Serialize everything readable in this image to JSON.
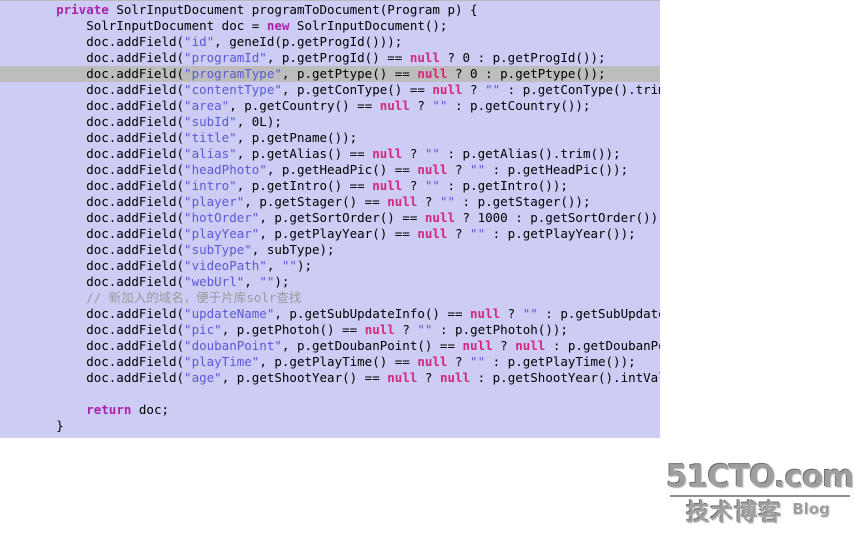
{
  "editor": {
    "language": "java",
    "background_color": "#ccccf4",
    "highlight_color": "#bdbdbd",
    "highlighted_line_index": 4,
    "colors": {
      "keyword": "#aa22aa",
      "string": "#5a5ad6",
      "null_literal": "#d4287a",
      "comment": "#9a9a9a",
      "text": "#000000"
    },
    "lines": [
      [
        {
          "t": "    ",
          "c": "plain"
        },
        {
          "t": "private",
          "c": "kw"
        },
        {
          "t": " SolrInputDocument programToDocument(Program p) {",
          "c": "plain"
        }
      ],
      [
        {
          "t": "        SolrInputDocument doc = ",
          "c": "plain"
        },
        {
          "t": "new",
          "c": "kw"
        },
        {
          "t": " SolrInputDocument();",
          "c": "plain"
        }
      ],
      [
        {
          "t": "        doc.addField(",
          "c": "plain"
        },
        {
          "t": "\"id\"",
          "c": "str"
        },
        {
          "t": ", geneId(p.getProgId()));",
          "c": "plain"
        }
      ],
      [
        {
          "t": "        doc.addField(",
          "c": "plain"
        },
        {
          "t": "\"programId\"",
          "c": "str"
        },
        {
          "t": ", p.getProgId() == ",
          "c": "plain"
        },
        {
          "t": "null",
          "c": "null"
        },
        {
          "t": " ? 0 : p.getProgId());",
          "c": "plain"
        }
      ],
      [
        {
          "t": "        doc.addField(",
          "c": "plain"
        },
        {
          "t": "\"programType\"",
          "c": "str"
        },
        {
          "t": ", p.getPtype() == ",
          "c": "plain"
        },
        {
          "t": "null",
          "c": "null"
        },
        {
          "t": " ? 0 : p.getPtype());",
          "c": "plain"
        }
      ],
      [
        {
          "t": "        doc.addField(",
          "c": "plain"
        },
        {
          "t": "\"contentType\"",
          "c": "str"
        },
        {
          "t": ", p.getConType() == ",
          "c": "plain"
        },
        {
          "t": "null",
          "c": "null"
        },
        {
          "t": " ? ",
          "c": "plain"
        },
        {
          "t": "\"\"",
          "c": "str"
        },
        {
          "t": " : p.getConType().trim());",
          "c": "plain"
        }
      ],
      [
        {
          "t": "        doc.addField(",
          "c": "plain"
        },
        {
          "t": "\"area\"",
          "c": "str"
        },
        {
          "t": ", p.getCountry() == ",
          "c": "plain"
        },
        {
          "t": "null",
          "c": "null"
        },
        {
          "t": " ? ",
          "c": "plain"
        },
        {
          "t": "\"\"",
          "c": "str"
        },
        {
          "t": " : p.getCountry());",
          "c": "plain"
        }
      ],
      [
        {
          "t": "        doc.addField(",
          "c": "plain"
        },
        {
          "t": "\"subId\"",
          "c": "str"
        },
        {
          "t": ", 0L);",
          "c": "plain"
        }
      ],
      [
        {
          "t": "        doc.addField(",
          "c": "plain"
        },
        {
          "t": "\"title\"",
          "c": "str"
        },
        {
          "t": ", p.getPname());",
          "c": "plain"
        }
      ],
      [
        {
          "t": "        doc.addField(",
          "c": "plain"
        },
        {
          "t": "\"alias\"",
          "c": "str"
        },
        {
          "t": ", p.getAlias() == ",
          "c": "plain"
        },
        {
          "t": "null",
          "c": "null"
        },
        {
          "t": " ? ",
          "c": "plain"
        },
        {
          "t": "\"\"",
          "c": "str"
        },
        {
          "t": " : p.getAlias().trim());",
          "c": "plain"
        }
      ],
      [
        {
          "t": "        doc.addField(",
          "c": "plain"
        },
        {
          "t": "\"headPhoto\"",
          "c": "str"
        },
        {
          "t": ", p.getHeadPic() == ",
          "c": "plain"
        },
        {
          "t": "null",
          "c": "null"
        },
        {
          "t": " ? ",
          "c": "plain"
        },
        {
          "t": "\"\"",
          "c": "str"
        },
        {
          "t": " : p.getHeadPic());",
          "c": "plain"
        }
      ],
      [
        {
          "t": "        doc.addField(",
          "c": "plain"
        },
        {
          "t": "\"intro\"",
          "c": "str"
        },
        {
          "t": ", p.getIntro() == ",
          "c": "plain"
        },
        {
          "t": "null",
          "c": "null"
        },
        {
          "t": " ? ",
          "c": "plain"
        },
        {
          "t": "\"\"",
          "c": "str"
        },
        {
          "t": " : p.getIntro());",
          "c": "plain"
        }
      ],
      [
        {
          "t": "        doc.addField(",
          "c": "plain"
        },
        {
          "t": "\"player\"",
          "c": "str"
        },
        {
          "t": ", p.getStager() == ",
          "c": "plain"
        },
        {
          "t": "null",
          "c": "null"
        },
        {
          "t": " ? ",
          "c": "plain"
        },
        {
          "t": "\"\"",
          "c": "str"
        },
        {
          "t": " : p.getStager());",
          "c": "plain"
        }
      ],
      [
        {
          "t": "        doc.addField(",
          "c": "plain"
        },
        {
          "t": "\"hotOrder\"",
          "c": "str"
        },
        {
          "t": ", p.getSortOrder() == ",
          "c": "plain"
        },
        {
          "t": "null",
          "c": "null"
        },
        {
          "t": " ? 1000 : p.getSortOrder());",
          "c": "plain"
        }
      ],
      [
        {
          "t": "        doc.addField(",
          "c": "plain"
        },
        {
          "t": "\"playYear\"",
          "c": "str"
        },
        {
          "t": ", p.getPlayYear() == ",
          "c": "plain"
        },
        {
          "t": "null",
          "c": "null"
        },
        {
          "t": " ? ",
          "c": "plain"
        },
        {
          "t": "\"\"",
          "c": "str"
        },
        {
          "t": " : p.getPlayYear());",
          "c": "plain"
        }
      ],
      [
        {
          "t": "        doc.addField(",
          "c": "plain"
        },
        {
          "t": "\"subType\"",
          "c": "str"
        },
        {
          "t": ", subType);",
          "c": "plain"
        }
      ],
      [
        {
          "t": "        doc.addField(",
          "c": "plain"
        },
        {
          "t": "\"videoPath\"",
          "c": "str"
        },
        {
          "t": ", ",
          "c": "plain"
        },
        {
          "t": "\"\"",
          "c": "str"
        },
        {
          "t": ");",
          "c": "plain"
        }
      ],
      [
        {
          "t": "        doc.addField(",
          "c": "plain"
        },
        {
          "t": "\"webUrl\"",
          "c": "str"
        },
        {
          "t": ", ",
          "c": "plain"
        },
        {
          "t": "\"\"",
          "c": "str"
        },
        {
          "t": ");",
          "c": "plain"
        }
      ],
      [
        {
          "t": "        // 新加入的域名，便于片库solr查找",
          "c": "cmt"
        }
      ],
      [
        {
          "t": "        doc.addField(",
          "c": "plain"
        },
        {
          "t": "\"updateName\"",
          "c": "str"
        },
        {
          "t": ", p.getSubUpdateInfo() == ",
          "c": "plain"
        },
        {
          "t": "null",
          "c": "null"
        },
        {
          "t": " ? ",
          "c": "plain"
        },
        {
          "t": "\"\"",
          "c": "str"
        },
        {
          "t": " : p.getSubUpdateInfo()",
          "c": "plain"
        }
      ],
      [
        {
          "t": "        doc.addField(",
          "c": "plain"
        },
        {
          "t": "\"pic\"",
          "c": "str"
        },
        {
          "t": ", p.getPhotoh() == ",
          "c": "plain"
        },
        {
          "t": "null",
          "c": "null"
        },
        {
          "t": " ? ",
          "c": "plain"
        },
        {
          "t": "\"\"",
          "c": "str"
        },
        {
          "t": " : p.getPhotoh());",
          "c": "plain"
        }
      ],
      [
        {
          "t": "        doc.addField(",
          "c": "plain"
        },
        {
          "t": "\"doubanPoint\"",
          "c": "str"
        },
        {
          "t": ", p.getDoubanPoint() == ",
          "c": "plain"
        },
        {
          "t": "null",
          "c": "null"
        },
        {
          "t": " ? ",
          "c": "plain"
        },
        {
          "t": "null",
          "c": "null"
        },
        {
          "t": " : p.getDoubanPoint())",
          "c": "plain"
        }
      ],
      [
        {
          "t": "        doc.addField(",
          "c": "plain"
        },
        {
          "t": "\"playTime\"",
          "c": "str"
        },
        {
          "t": ", p.getPlayTime() == ",
          "c": "plain"
        },
        {
          "t": "null",
          "c": "null"
        },
        {
          "t": " ? ",
          "c": "plain"
        },
        {
          "t": "\"\"",
          "c": "str"
        },
        {
          "t": " : p.getPlayTime());",
          "c": "plain"
        }
      ],
      [
        {
          "t": "        doc.addField(",
          "c": "plain"
        },
        {
          "t": "\"age\"",
          "c": "str"
        },
        {
          "t": ", p.getShootYear() == ",
          "c": "plain"
        },
        {
          "t": "null",
          "c": "null"
        },
        {
          "t": " ? ",
          "c": "plain"
        },
        {
          "t": "null",
          "c": "null"
        },
        {
          "t": " : p.getShootYear().intValue());",
          "c": "plain"
        }
      ],
      [
        {
          "t": "",
          "c": "plain"
        }
      ],
      [
        {
          "t": "        ",
          "c": "plain"
        },
        {
          "t": "return",
          "c": "kw"
        },
        {
          "t": " doc;",
          "c": "plain"
        }
      ],
      [
        {
          "t": "    }",
          "c": "plain"
        }
      ]
    ]
  },
  "watermark": {
    "site": "51CTO.com",
    "cn_label": "技术博客",
    "en_label": "Blog"
  }
}
